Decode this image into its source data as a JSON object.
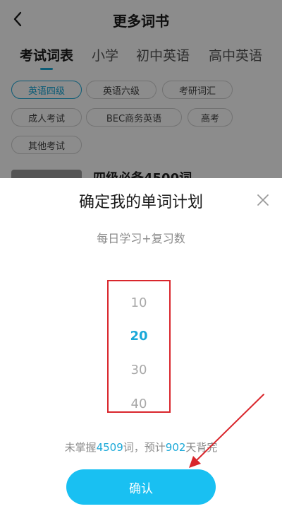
{
  "header": {
    "title": "更多词书"
  },
  "tabs": [
    {
      "label": "考试词表",
      "active": true
    },
    {
      "label": "小学",
      "active": false
    },
    {
      "label": "初中英语",
      "active": false
    },
    {
      "label": "高中英语",
      "active": false
    }
  ],
  "chips": [
    {
      "label": "英语四级",
      "active": true
    },
    {
      "label": "英语六级",
      "active": false
    },
    {
      "label": "考研词汇",
      "active": false
    },
    {
      "label": "成人考试",
      "active": false
    },
    {
      "label": "BEC商务英语",
      "active": false
    },
    {
      "label": "高考",
      "active": false
    },
    {
      "label": "其他考试",
      "active": false
    }
  ],
  "book": {
    "title": "四级必备4500词"
  },
  "dialog": {
    "title": "确定我的单词计划",
    "subtitle": "每日学习+复习数",
    "picker": {
      "options": [
        "10",
        "20",
        "30",
        "40"
      ],
      "selected": "20"
    },
    "summary": {
      "prefix": "未掌握",
      "words": "4509",
      "middle": "词，预计",
      "days": "902",
      "suffix": "天背完"
    },
    "confirm_label": "确认"
  },
  "colors": {
    "accent": "#19a8d8",
    "button": "#19c0f2",
    "annotation": "#d9262c"
  }
}
